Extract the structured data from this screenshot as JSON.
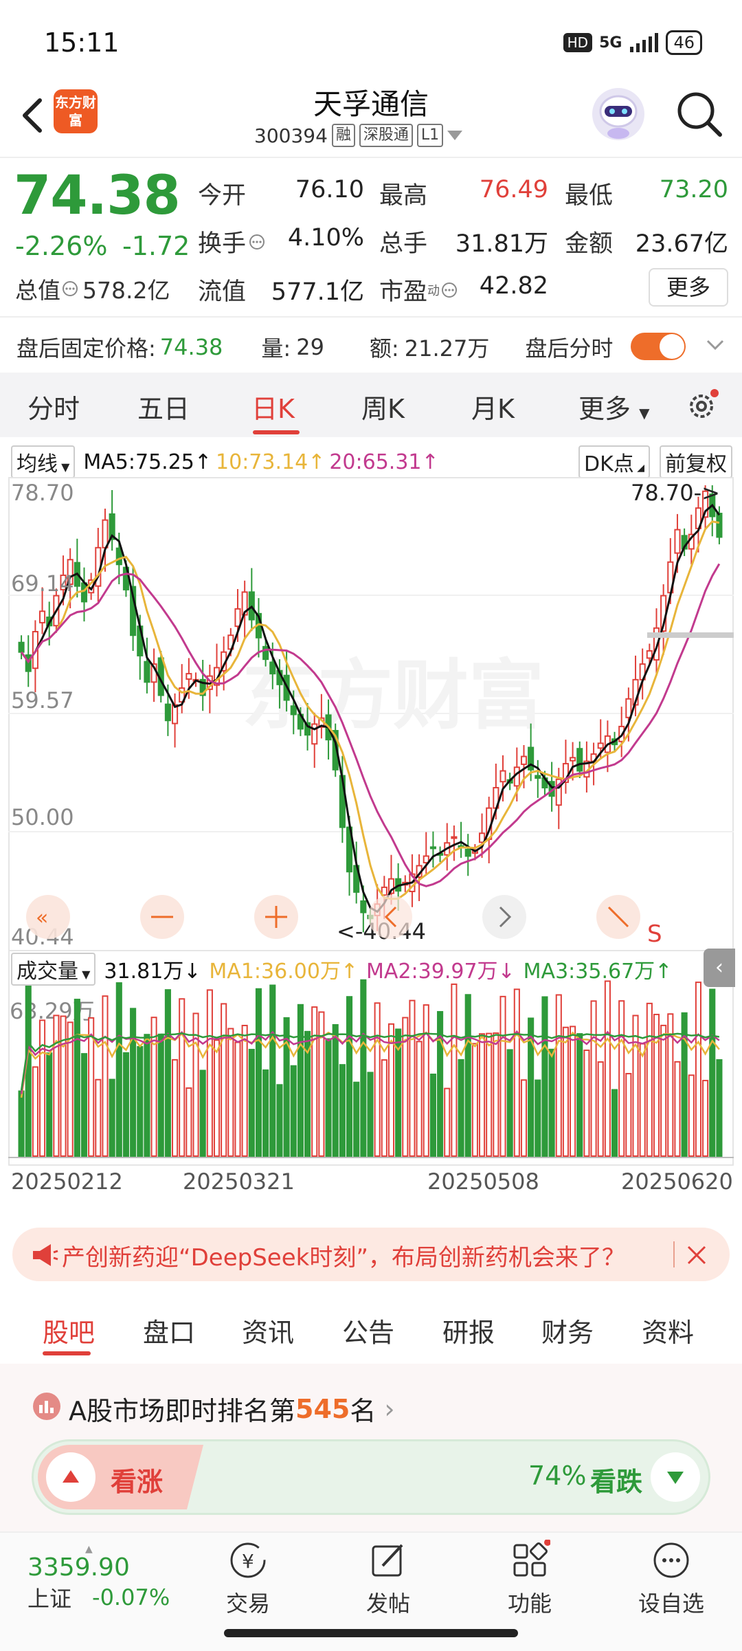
{
  "status_bar": {
    "time": "15:11",
    "hd": "HD",
    "network": "5G",
    "battery": "46"
  },
  "header": {
    "brand": "东方财富",
    "name": "天孚通信",
    "code": "300394",
    "tags": [
      "融",
      "深股通",
      "L1"
    ]
  },
  "quote": {
    "price": "74.38",
    "change_pct": "-2.26%",
    "change": "-1.72",
    "open_label": "今开",
    "open": "76.10",
    "high_label": "最高",
    "high": "76.49",
    "low_label": "最低",
    "low": "73.20",
    "turnover_label": "换手",
    "turnover": "4.10%",
    "volume_label": "总手",
    "volume": "31.81万",
    "amount_label": "金额",
    "amount": "23.67亿",
    "mktcap_label": "总值",
    "mktcap": "578.2亿",
    "float_label": "流值",
    "float": "577.1亿",
    "pe_label": "市盈",
    "pe_sup": "动",
    "pe": "42.82",
    "more": "更多"
  },
  "after_hours": {
    "price_label": "盘后固定价格:",
    "price": "74.38",
    "vol_label": "量:",
    "vol": "29",
    "amt_label": "额:",
    "amt": "21.27万",
    "chart_label": "盘后分时"
  },
  "tabs": [
    "分时",
    "五日",
    "日K",
    "周K",
    "月K",
    "更多"
  ],
  "ma_legend": {
    "selector": "均线",
    "ma5": "MA5:75.25↑",
    "ma10": "10:73.14↑",
    "ma20": "20:65.31↑",
    "dk": "DK点",
    "adjust": "前复权"
  },
  "volume_legend": {
    "selector": "成交量",
    "vol": "31.81万↓",
    "ma1": "MA1:36.00万↑",
    "ma2": "MA2:39.97万↓",
    "ma3": "MA3:35.67万↑"
  },
  "colors": {
    "up": "#e0403a",
    "down": "#2e9a3a",
    "accent": "#ee6d2a",
    "ma5": "#111111",
    "ma10": "#e8b53a",
    "ma20": "#c23a8e"
  },
  "chart_data": {
    "type": "candlestick",
    "y_axis_labels": [
      "78.70",
      "69.14",
      "59.57",
      "50.00",
      "40.44"
    ],
    "ylim": [
      40.44,
      78.7
    ],
    "annotations": {
      "max": "78.70->",
      "min": "<-40.44",
      "signal": "S"
    },
    "volume_max_label": "63.29万",
    "x_labels": [
      "20250212",
      "20250321",
      "20250508",
      "20250620"
    ],
    "closes": [
      64.8,
      63.2,
      66.5,
      68.2,
      67.0,
      69.5,
      71.2,
      72.5,
      70.3,
      69.0,
      70.8,
      73.5,
      75.8,
      74.2,
      72.1,
      70.0,
      66.2,
      64.5,
      62.3,
      63.8,
      61.2,
      59.1,
      60.4,
      61.8,
      63.0,
      62.5,
      61.2,
      62.8,
      63.5,
      64.8,
      66.2,
      68.4,
      69.8,
      67.5,
      66.0,
      64.2,
      63.0,
      62.1,
      60.8,
      59.6,
      58.4,
      57.9,
      58.8,
      59.3,
      57.5,
      55.0,
      50.2,
      46.5,
      44.8,
      43.1,
      42.6,
      43.8,
      45.2,
      45.9,
      44.9,
      45.6,
      46.3,
      47.0,
      47.8,
      48.5,
      47.9,
      48.9,
      49.4,
      48.6,
      47.8,
      48.2,
      49.7,
      51.8,
      53.5,
      54.9,
      53.9,
      55.2,
      56.1,
      55.0,
      54.3,
      53.5,
      52.8,
      54.2,
      55.5,
      56.0,
      54.9,
      55.7,
      56.3,
      57.2,
      57.8,
      57.1,
      58.6,
      60.9,
      62.5,
      63.8,
      64.9,
      66.8,
      69.5,
      72.3,
      75.0,
      73.4,
      74.6,
      76.8,
      78.2,
      76.1,
      74.38
    ],
    "ma5_last": "75.25",
    "ma10_last": "73.14",
    "ma20_last": "65.31"
  },
  "news": {
    "text": "产创新药迎“DeepSeek时刻”，布局创新药机会来了？"
  },
  "bottom_tabs": [
    "股吧",
    "盘口",
    "资讯",
    "公告",
    "研报",
    "财务",
    "资料"
  ],
  "ranking": {
    "prefix": "A股市场即时排名第",
    "rank": "545",
    "suffix": "名",
    "bull_label": "看涨",
    "bear_pct": "74%",
    "bear_label": "看跌",
    "bear_fraction": 0.74
  },
  "bottom_nav": {
    "index_value": "3359.90",
    "index_name": "上证",
    "index_change": "-0.07%",
    "items": [
      "交易",
      "发帖",
      "功能",
      "设自选"
    ]
  }
}
